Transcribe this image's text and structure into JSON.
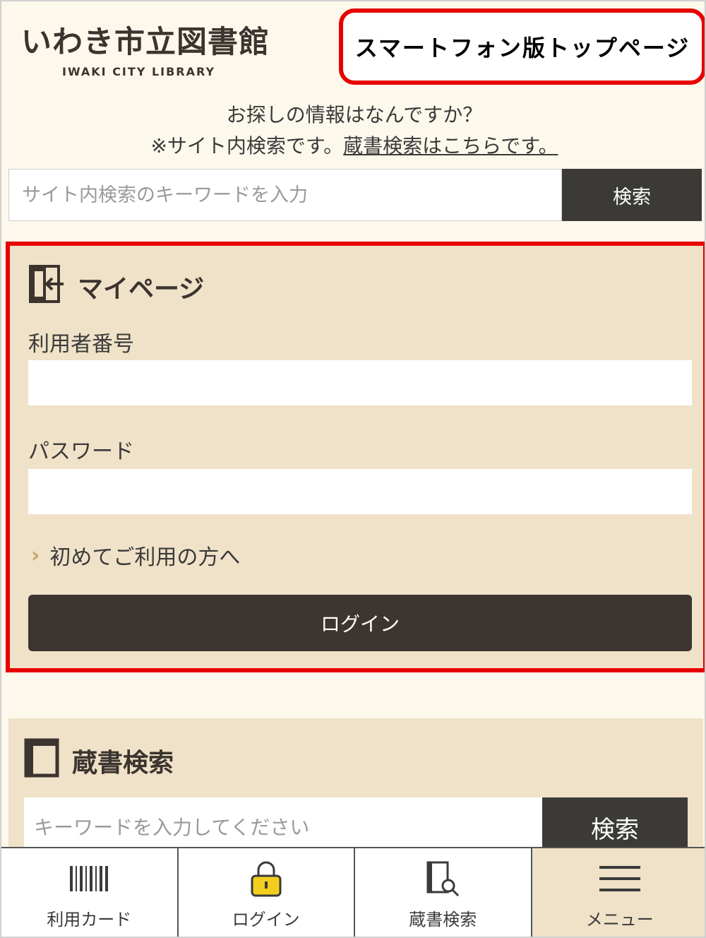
{
  "header": {
    "logo_jp": "いわき市立図書館",
    "logo_en": "IWAKI CITY LIBRARY",
    "callout": "スマートフォン版トップページ"
  },
  "site_search": {
    "question": "お探しの情報はなんですか？",
    "note_prefix": "※サイト内検索です。",
    "note_link": "蔵書検索はこちらです。",
    "placeholder": "サイト内検索のキーワードを入力",
    "button_label": "検索"
  },
  "mypage": {
    "title": "マイページ",
    "title_icon": "login-door-icon",
    "user_number_label": "利用者番号",
    "password_label": "パスワード",
    "first_time_link": "初めてご利用の方へ",
    "login_button": "ログイン"
  },
  "catalog": {
    "title": "蔵書検索",
    "title_icon": "book-icon",
    "placeholder": "キーワードを入力してください",
    "button_label": "検索"
  },
  "bottom_nav": [
    {
      "label": "利用カード",
      "icon": "barcode-icon"
    },
    {
      "label": "ログイン",
      "icon": "padlock-icon"
    },
    {
      "label": "蔵書検索",
      "icon": "book-search-icon"
    },
    {
      "label": "メニュー",
      "icon": "hamburger-menu-icon"
    }
  ],
  "colors": {
    "background": "#fdf8ec",
    "panel": "#f0e2c8",
    "dark_button": "#3c3530",
    "highlight_red": "#e60000",
    "lock_yellow": "#f2cf1f"
  }
}
